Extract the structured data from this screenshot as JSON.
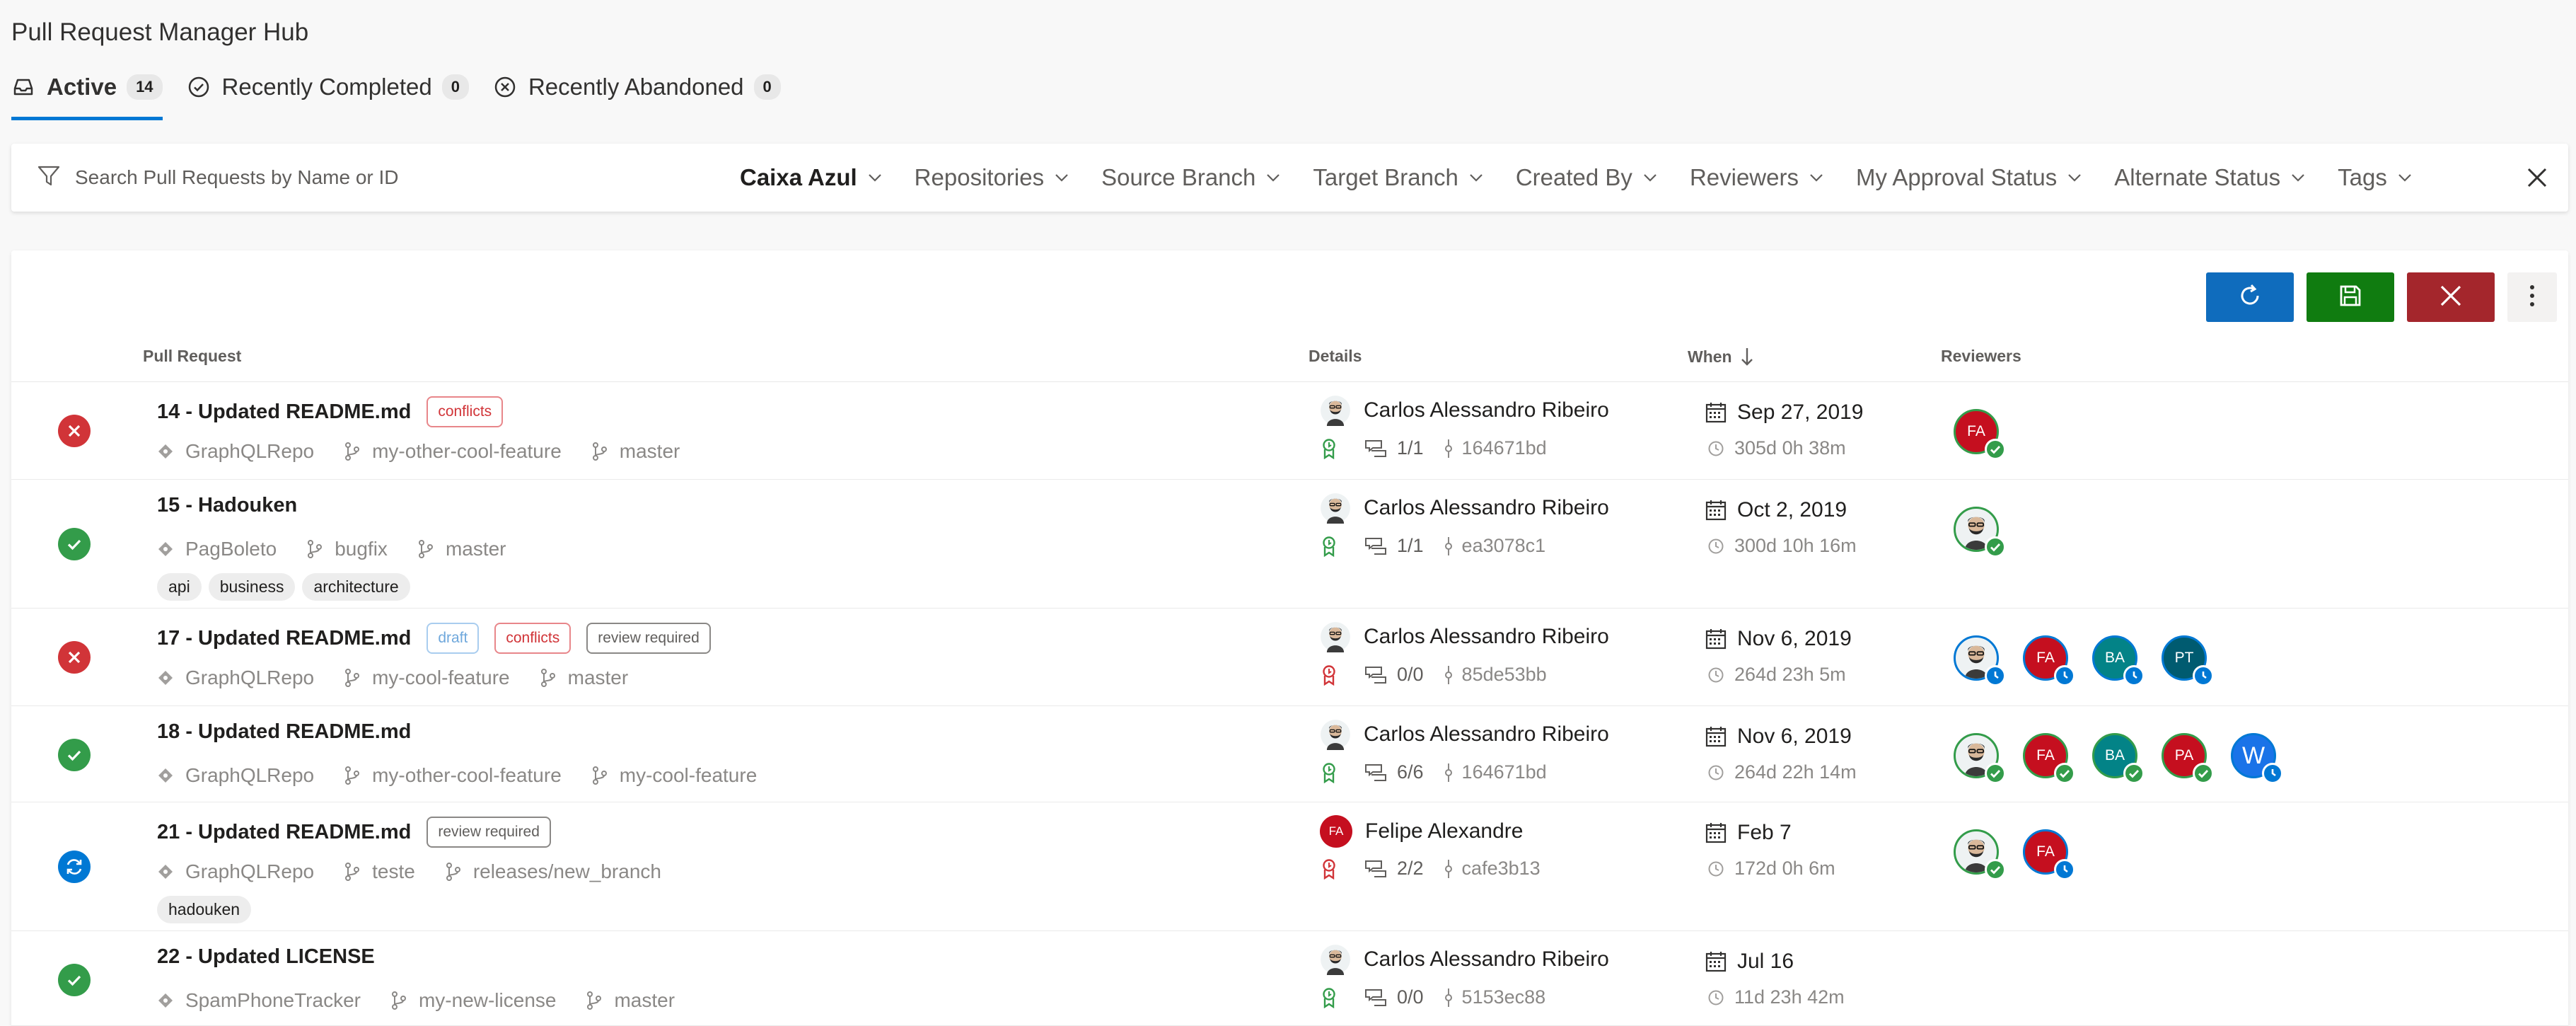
{
  "app": {
    "title": "Pull Request Manager Hub"
  },
  "tabs": [
    {
      "label": "Active",
      "count": "14",
      "icon": "inbox-icon"
    },
    {
      "label": "Recently Completed",
      "count": "0",
      "icon": "check-circle-icon"
    },
    {
      "label": "Recently Abandoned",
      "count": "0",
      "icon": "x-circle-icon"
    }
  ],
  "filter": {
    "placeholder": "Search Pull Requests by Name or ID",
    "dropdowns": [
      "Caixa Azul",
      "Repositories",
      "Source Branch",
      "Target Branch",
      "Created By",
      "Reviewers",
      "My Approval Status",
      "Alternate Status",
      "Tags"
    ]
  },
  "table": {
    "headers": {
      "pull_request": "Pull Request",
      "details": "Details",
      "when": "When",
      "reviewers": "Reviewers"
    }
  },
  "colors": {
    "accent": "#0078d4",
    "success": "#339c4a",
    "danger": "#d13438",
    "save": "#107c10",
    "cancel": "#a4262c"
  },
  "rows": [
    {
      "status": "failed",
      "title": "14 - Updated README.md",
      "pills": [
        "conflicts"
      ],
      "repo": "GraphQLRepo",
      "source": "my-other-cool-feature",
      "target": "master",
      "labels": [],
      "author": "Carlos Alessandro Ribeiro",
      "author_avatar": "photo",
      "policy": "ok",
      "threads": "1/1",
      "commit": "164671bd",
      "date": "Sep 27, 2019",
      "ago": "305d 0h 38m",
      "reviewers": [
        {
          "initials": "FA",
          "color": "#c50f1f",
          "vote": "approved"
        }
      ]
    },
    {
      "status": "succeeded",
      "title": "15 - Hadouken",
      "pills": [],
      "repo": "PagBoleto",
      "source": "bugfix",
      "target": "master",
      "labels": [
        "api",
        "business",
        "architecture"
      ],
      "author": "Carlos Alessandro Ribeiro",
      "author_avatar": "photo",
      "policy": "ok",
      "threads": "1/1",
      "commit": "ea3078c1",
      "date": "Oct 2, 2019",
      "ago": "300d 10h 16m",
      "reviewers": [
        {
          "initials": "",
          "color": "photo",
          "vote": "approved"
        }
      ]
    },
    {
      "status": "failed",
      "title": "17 - Updated README.md",
      "pills": [
        "draft",
        "conflicts",
        "review required"
      ],
      "repo": "GraphQLRepo",
      "source": "my-cool-feature",
      "target": "master",
      "labels": [],
      "author": "Carlos Alessandro Ribeiro",
      "author_avatar": "photo",
      "policy": "fail",
      "threads": "0/0",
      "commit": "85de53bb",
      "date": "Nov 6, 2019",
      "ago": "264d 23h 5m",
      "reviewers": [
        {
          "initials": "",
          "color": "photo",
          "vote": "waiting"
        },
        {
          "initials": "FA",
          "color": "#c50f1f",
          "vote": "waiting"
        },
        {
          "initials": "BA",
          "color": "#038387",
          "vote": "waiting"
        },
        {
          "initials": "PT",
          "color": "#005b70",
          "vote": "waiting"
        }
      ]
    },
    {
      "status": "succeeded",
      "title": "18 - Updated README.md",
      "pills": [],
      "repo": "GraphQLRepo",
      "source": "my-other-cool-feature",
      "target": "my-cool-feature",
      "labels": [],
      "author": "Carlos Alessandro Ribeiro",
      "author_avatar": "photo",
      "policy": "ok",
      "threads": "6/6",
      "commit": "164671bd",
      "date": "Nov 6, 2019",
      "ago": "264d 22h 14m",
      "reviewers": [
        {
          "initials": "",
          "color": "photo",
          "vote": "approved"
        },
        {
          "initials": "FA",
          "color": "#c50f1f",
          "vote": "approved"
        },
        {
          "initials": "BA",
          "color": "#038387",
          "vote": "approved"
        },
        {
          "initials": "PA",
          "color": "#c50f1f",
          "vote": "approved"
        },
        {
          "initials": "W",
          "color": "#1a73e8",
          "vote": "waiting"
        }
      ]
    },
    {
      "status": "pending",
      "title": "21 - Updated README.md",
      "pills": [
        "review required"
      ],
      "repo": "GraphQLRepo",
      "source": "teste",
      "target": "releases/new_branch",
      "labels": [
        "hadouken"
      ],
      "author": "Felipe Alexandre",
      "author_avatar": "FA",
      "policy": "fail",
      "threads": "2/2",
      "commit": "cafe3b13",
      "date": "Feb 7",
      "ago": "172d 0h 6m",
      "reviewers": [
        {
          "initials": "",
          "color": "photo",
          "vote": "approved"
        },
        {
          "initials": "FA",
          "color": "#c50f1f",
          "vote": "waiting"
        }
      ]
    },
    {
      "status": "succeeded",
      "title": "22 - Updated LICENSE",
      "pills": [],
      "repo": "SpamPhoneTracker",
      "source": "my-new-license",
      "target": "master",
      "labels": [],
      "author": "Carlos Alessandro Ribeiro",
      "author_avatar": "photo",
      "policy": "ok",
      "threads": "0/0",
      "commit": "5153ec88",
      "date": "Jul 16",
      "ago": "11d 23h 42m",
      "reviewers": []
    }
  ]
}
